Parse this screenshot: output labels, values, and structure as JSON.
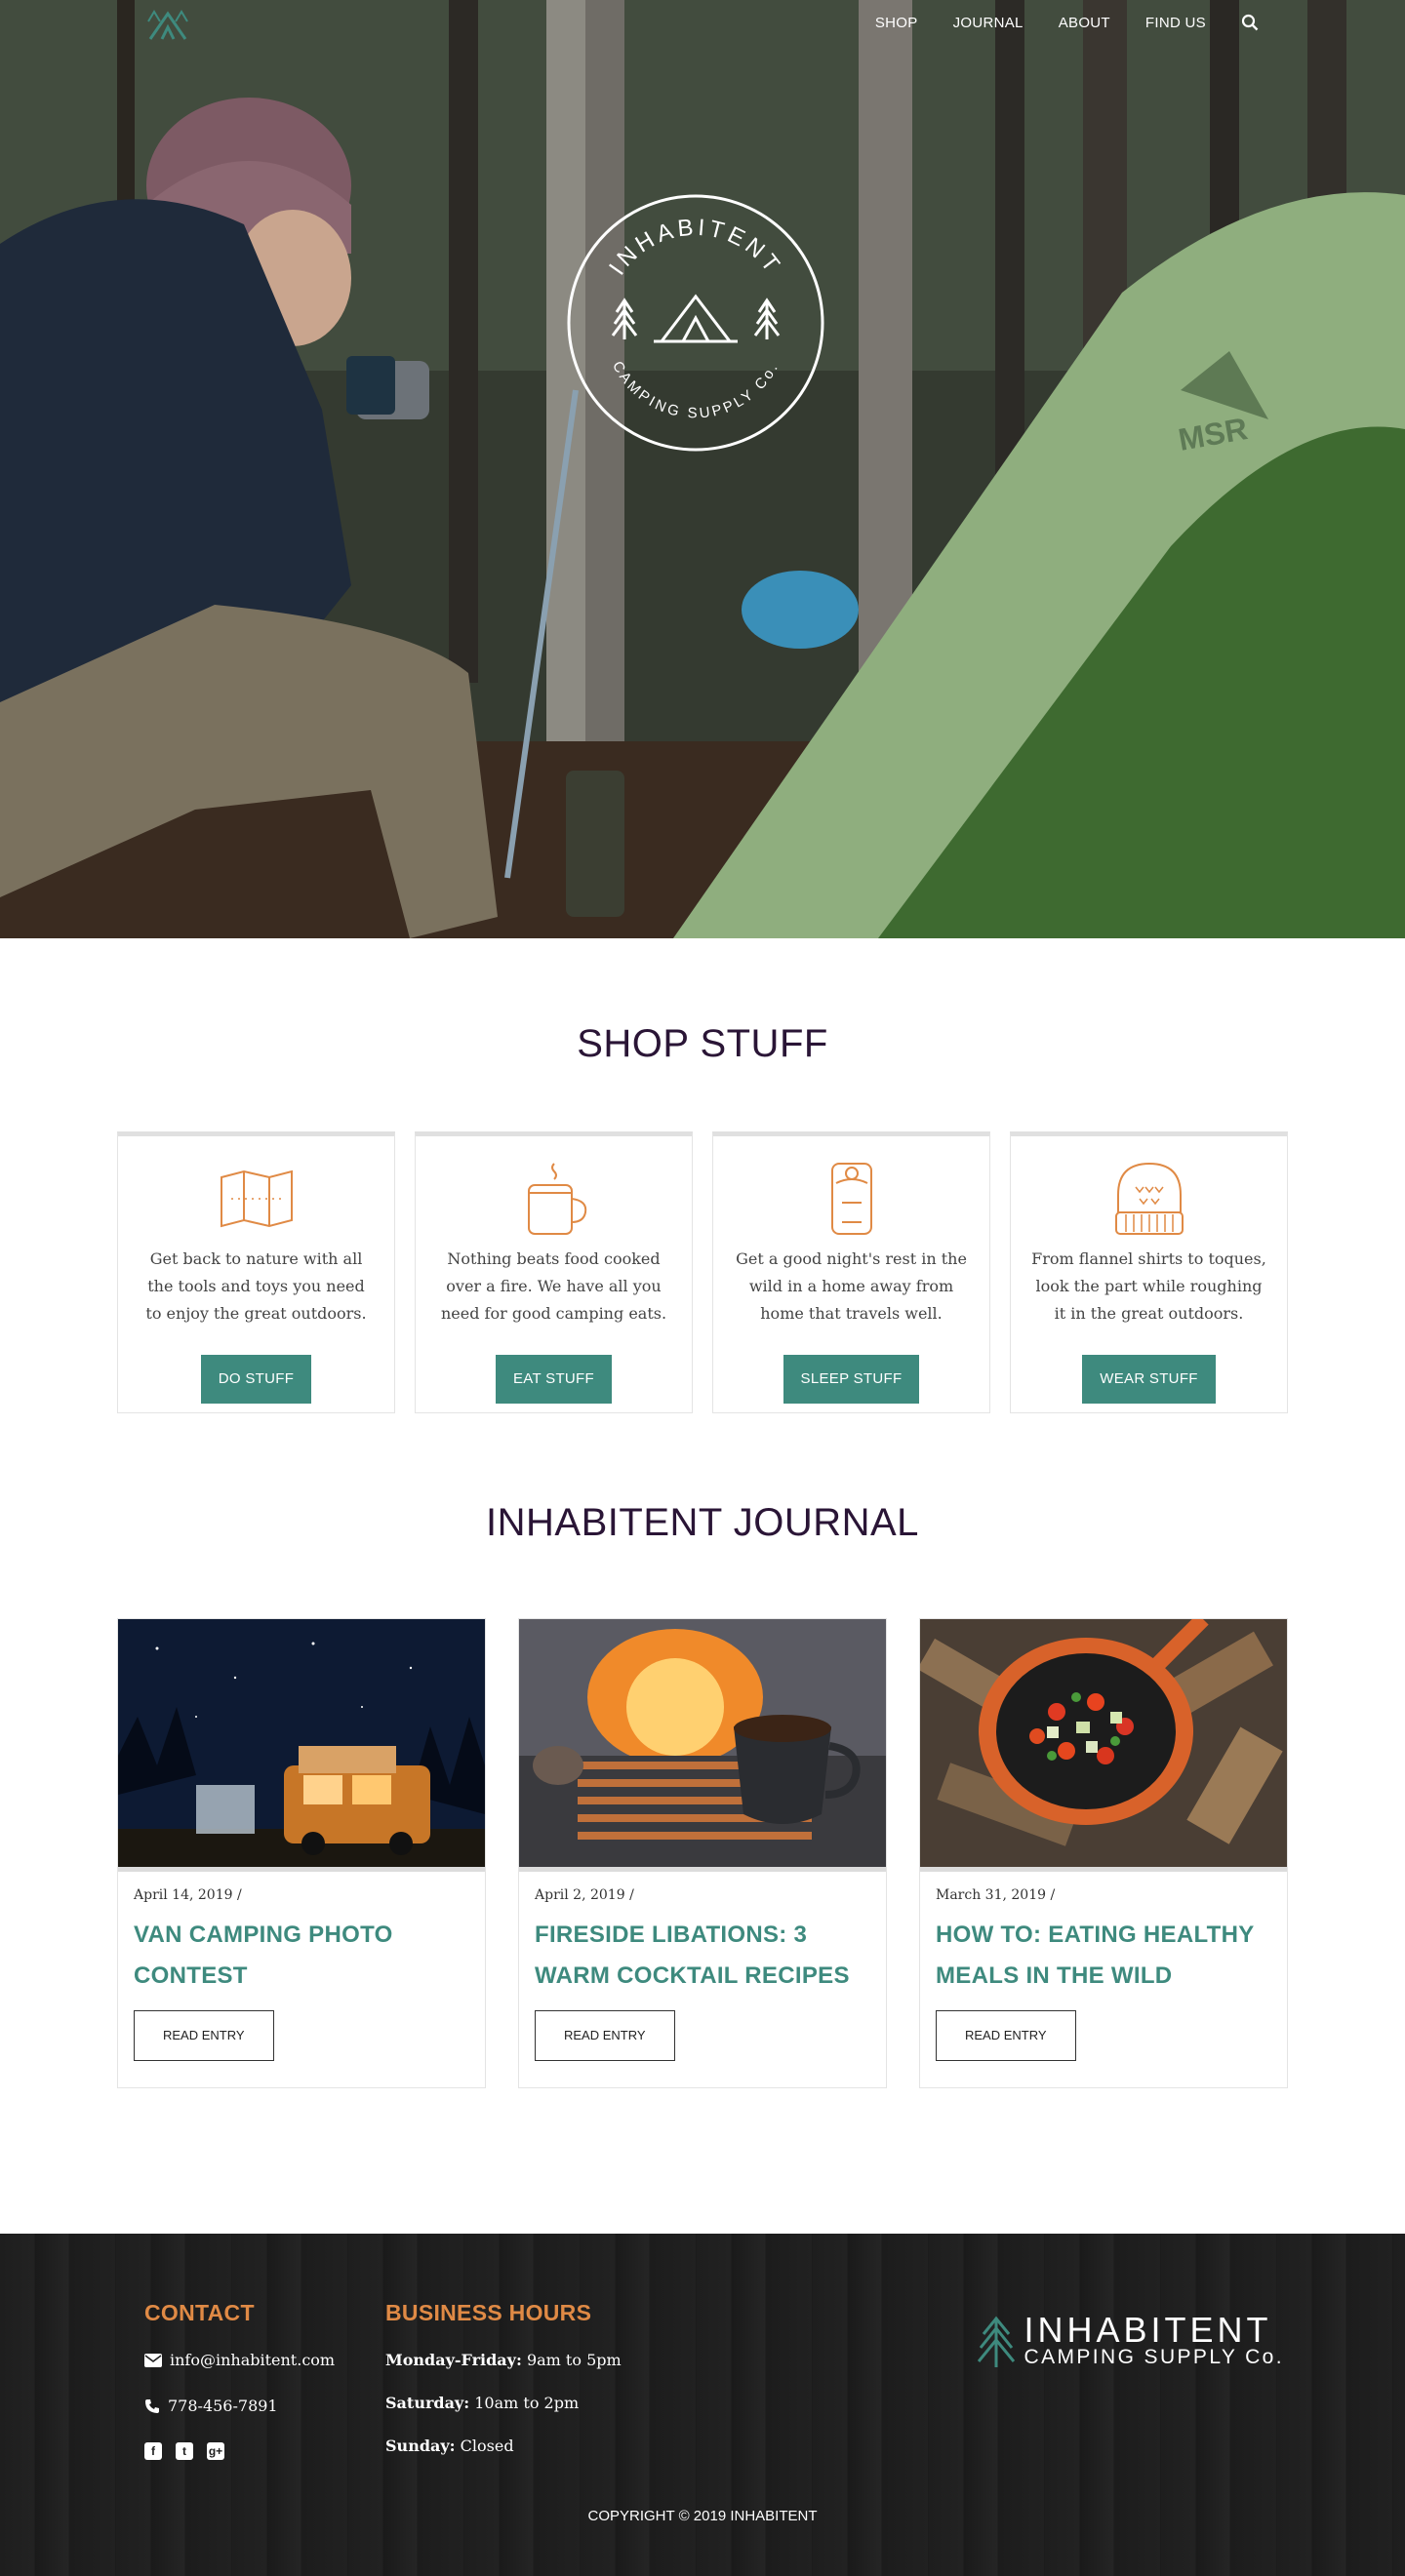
{
  "nav": {
    "items": [
      {
        "label": "SHOP"
      },
      {
        "label": "JOURNAL"
      },
      {
        "label": "ABOUT"
      },
      {
        "label": "FIND US"
      }
    ],
    "search_icon": "search-icon",
    "logo_icon": "tent-logo-icon"
  },
  "hero": {
    "badge_top": "INHABITENT",
    "badge_bottom": "CAMPING SUPPLY Co.",
    "tent_brand": "MSR"
  },
  "shop": {
    "title": "SHOP STUFF",
    "cards": [
      {
        "icon": "map-icon",
        "text": "Get back to nature with all the tools and toys you need to enjoy the great outdoors.",
        "button": "DO STUFF"
      },
      {
        "icon": "mug-icon",
        "text": "Nothing beats food cooked over a fire. We have all you need for good camping eats.",
        "button": "EAT STUFF"
      },
      {
        "icon": "sleeping-bag-icon",
        "text": "Get a good night's rest in the wild in a home away from home that travels well.",
        "button": "SLEEP STUFF"
      },
      {
        "icon": "toque-icon",
        "text": "From flannel shirts to toques, look the part while roughing it in the great outdoors.",
        "button": "WEAR STUFF"
      }
    ]
  },
  "journal": {
    "title": "INHABITENT JOURNAL",
    "posts": [
      {
        "date": "April 14, 2019",
        "separator": "/",
        "title": "VAN CAMPING PHOTO CONTEST",
        "button": "READ ENTRY"
      },
      {
        "date": "April 2, 2019",
        "separator": "/",
        "title": "FIRESIDE LIBATIONS: 3 WARM COCKTAIL RECIPES",
        "button": "READ ENTRY"
      },
      {
        "date": "March 31, 2019",
        "separator": "/",
        "title": "HOW TO: EATING HEALTHY MEALS IN THE WILD",
        "button": "READ ENTRY"
      }
    ]
  },
  "footer": {
    "contact": {
      "title": "CONTACT",
      "email": "info@inhabitent.com",
      "phone": "778-456-7891",
      "social": [
        "facebook-icon",
        "twitter-icon",
        "google-plus-icon"
      ]
    },
    "hours": {
      "title": "BUSINESS HOURS",
      "lines": [
        {
          "day": "Monday-Friday:",
          "time": "9am to 5pm"
        },
        {
          "day": "Saturday:",
          "time": "10am to 2pm"
        },
        {
          "day": "Sunday:",
          "time": "Closed"
        }
      ]
    },
    "brand": {
      "name": "INHABITENT",
      "sub": "CAMPING SUPPLY Co."
    },
    "copyright": "COPYRIGHT © 2019 INHABITENT"
  },
  "colors": {
    "accent_teal": "#3e8a7e",
    "accent_orange": "#e08a45",
    "title_purple": "#2a1536"
  }
}
